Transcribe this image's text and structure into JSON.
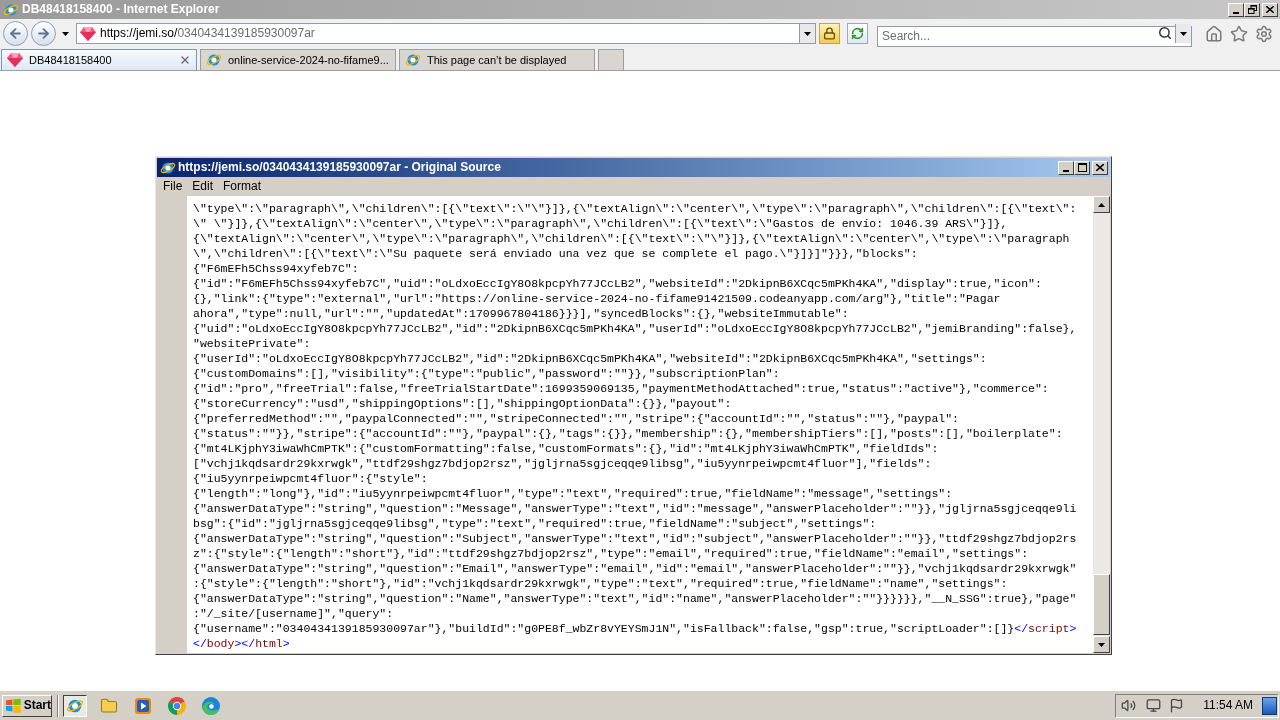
{
  "browser": {
    "title": "DB48418158400 - Internet Explorer",
    "address": {
      "host": "https://jemi.so/",
      "path": "0340434139185930097ar"
    },
    "search": {
      "placeholder": "Search..."
    },
    "tabs": [
      {
        "label": "DB48418158400",
        "kind": "site",
        "selected": true
      },
      {
        "label": "online-service-2024-no-fifame9...",
        "kind": "default",
        "selected": false
      },
      {
        "label": "This page can’t be displayed",
        "kind": "default",
        "selected": false
      }
    ]
  },
  "source_window": {
    "title": "https://jemi.so/0340434139185930097ar - Original Source",
    "menu": [
      "File",
      "Edit",
      "Format"
    ],
    "lines": [
      [
        {
          "kind": "text",
          "text": "\\\"type\\\":\\\"paragraph\\\",\\\"children\\\":[{\\\"text\\\":\\\"\\\"}]},{\\\"textAlign\\\":\\\"center\\\",\\\"type\\\":\\\"paragraph\\\",\\\"children\\\":[{\\\"text\\\":"
        }
      ],
      [
        {
          "kind": "text",
          "text": "\\\" \\\"}]},{\\\"textAlign\\\":\\\"center\\\",\\\"type\\\":\\\"paragraph\\\",\\\"children\\\":[{\\\"text\\\":\\\"Gastos de envío: 1046.39 ARS\\\"}]},"
        }
      ],
      [
        {
          "kind": "text",
          "text": "{\\\"textAlign\\\":\\\"center\\\",\\\"type\\\":\\\"paragraph\\\",\\\"children\\\":[{\\\"text\\\":\\\"\\\"}]},{\\\"textAlign\\\":\\\"center\\\",\\\"type\\\":\\\"paragraph"
        }
      ],
      [
        {
          "kind": "text",
          "text": "\\\",\\\"children\\\":[{\\\"text\\\":\\\"Su paquete será enviado una vez que se complete el pago.\\\"}]}]\"}}},\"blocks\":"
        }
      ],
      [
        {
          "kind": "text",
          "text": "{\"F6mEFh5Chss94xyfeb7C\":"
        }
      ],
      [
        {
          "kind": "text",
          "text": "{\"id\":\"F6mEFh5Chss94xyfeb7C\",\"uid\":\"oLdxoEccIgY8O8kpcpYh77JCcLB2\",\"websiteId\":\"2DkipnB6XCqc5mPKh4KA\",\"display\":true,\"icon\":"
        }
      ],
      [
        {
          "kind": "text",
          "text": "{},\"link\":{\"type\":\"external\",\"url\":\"https://online-service-2024-no-fifame91421509.codeanyapp.com/arg\"},\"title\":\"Pagar"
        }
      ],
      [
        {
          "kind": "text",
          "text": "ahora\",\"type\":null,\"url\":\"\",\"updatedAt\":1709967804186}}}],\"syncedBlocks\":{},\"websiteImmutable\":"
        }
      ],
      [
        {
          "kind": "text",
          "text": "{\"uid\":\"oLdxoEccIgY8O8kpcpYh77JCcLB2\",\"id\":\"2DkipnB6XCqc5mPKh4KA\",\"userId\":\"oLdxoEccIgY8O8kpcpYh77JCcLB2\",\"jemiBranding\":false},"
        }
      ],
      [
        {
          "kind": "text",
          "text": "\"websitePrivate\":"
        }
      ],
      [
        {
          "kind": "text",
          "text": "{\"userId\":\"oLdxoEccIgY8O8kpcpYh77JCcLB2\",\"id\":\"2DkipnB6XCqc5mPKh4KA\",\"websiteId\":\"2DkipnB6XCqc5mPKh4KA\",\"settings\":"
        }
      ],
      [
        {
          "kind": "text",
          "text": "{\"customDomains\":[],\"visibility\":{\"type\":\"public\",\"password\":\"\"}},\"subscriptionPlan\":"
        }
      ],
      [
        {
          "kind": "text",
          "text": "{\"id\":\"pro\",\"freeTrial\":false,\"freeTrialStartDate\":1699359069135,\"paymentMethodAttached\":true,\"status\":\"active\"},\"commerce\":"
        }
      ],
      [
        {
          "kind": "text",
          "text": "{\"storeCurrency\":\"usd\",\"shippingOptions\":[],\"shippingOptionData\":{}},\"payout\":"
        }
      ],
      [
        {
          "kind": "text",
          "text": "{\"preferredMethod\":\"\",\"paypalConnected\":\"\",\"stripeConnected\":\"\",\"stripe\":{\"accountId\":\"\",\"status\":\"\"},\"paypal\":"
        }
      ],
      [
        {
          "kind": "text",
          "text": "{\"status\":\"\"}},\"stripe\":{\"accountId\":\"\"},\"paypal\":{},\"tags\":{}},\"membership\":{},\"membershipTiers\":[],\"posts\":[],\"boilerplate\":"
        }
      ],
      [
        {
          "kind": "text",
          "text": "{\"mt4LKjphY3iwaWhCmPTK\":{\"customFormatting\":false,\"customFormats\":{},\"id\":\"mt4LKjphY3iwaWhCmPTK\",\"fieldIds\":"
        }
      ],
      [
        {
          "kind": "text",
          "text": "[\"vchj1kqdsardr29kxrwgk\",\"ttdf29shgz7bdjop2rsz\",\"jgljrna5sgjceqqe9libsg\",\"iu5yynrpeiwpcmt4fluor\"],\"fields\":"
        }
      ],
      [
        {
          "kind": "text",
          "text": "{\"iu5yynrpeiwpcmt4fluor\":{\"style\":"
        }
      ],
      [
        {
          "kind": "text",
          "text": "{\"length\":\"long\"},\"id\":\"iu5yynrpeiwpcmt4fluor\",\"type\":\"text\",\"required\":true,\"fieldName\":\"message\",\"settings\":"
        }
      ],
      [
        {
          "kind": "text",
          "text": "{\"answerDataType\":\"string\",\"question\":\"Message\",\"answerType\":\"text\",\"id\":\"message\",\"answerPlaceholder\":\"\"}},\"jgljrna5sgjceqqe9li"
        }
      ],
      [
        {
          "kind": "text",
          "text": "bsg\":{\"id\":\"jgljrna5sgjceqqe9libsg\",\"type\":\"text\",\"required\":true,\"fieldName\":\"subject\",\"settings\":"
        }
      ],
      [
        {
          "kind": "text",
          "text": "{\"answerDataType\":\"string\",\"question\":\"Subject\",\"answerType\":\"text\",\"id\":\"subject\",\"answerPlaceholder\":\"\"}},\"ttdf29shgz7bdjop2rs"
        }
      ],
      [
        {
          "kind": "text",
          "text": "z\":{\"style\":{\"length\":\"short\"},\"id\":\"ttdf29shgz7bdjop2rsz\",\"type\":\"email\",\"required\":true,\"fieldName\":\"email\",\"settings\":"
        }
      ],
      [
        {
          "kind": "text",
          "text": "{\"answerDataType\":\"string\",\"question\":\"Email\",\"answerType\":\"email\",\"id\":\"email\",\"answerPlaceholder\":\"\"}},\"vchj1kqdsardr29kxrwgk\""
        }
      ],
      [
        {
          "kind": "text",
          "text": ":{\"style\":{\"length\":\"short\"},\"id\":\"vchj1kqdsardr29kxrwgk\",\"type\":\"text\",\"required\":true,\"fieldName\":\"name\",\"settings\":"
        }
      ],
      [
        {
          "kind": "text",
          "text": "{\"answerDataType\":\"string\",\"question\":\"Name\",\"answerType\":\"text\",\"id\":\"name\",\"answerPlaceholder\":\"\"}}}}}},\"__N_SSG\":true},\"page\""
        }
      ],
      [
        {
          "kind": "text",
          "text": ":\"/_site/[username]\",\"query\":"
        }
      ],
      [
        {
          "kind": "text",
          "text": "{\"username\":\"0340434139185930097ar\"},\"buildId\":\"g0PE8f_wbZr8vYEYSmJ1N\",\"isFallback\":false,\"gsp\":true,\"scriptLoader\":[]}"
        },
        {
          "kind": "delim",
          "text": "</"
        },
        {
          "kind": "tag",
          "text": "script"
        },
        {
          "kind": "delim",
          "text": ">"
        }
      ],
      [
        {
          "kind": "delim",
          "text": "</"
        },
        {
          "kind": "tag",
          "text": "body"
        },
        {
          "kind": "delim",
          "text": "></"
        },
        {
          "kind": "tag",
          "text": "html"
        },
        {
          "kind": "delim",
          "text": ">"
        }
      ]
    ]
  },
  "taskbar": {
    "start": "Start",
    "apps": [
      {
        "kind": "ie",
        "active": true
      },
      {
        "kind": "folder",
        "active": false
      },
      {
        "kind": "media",
        "active": false
      },
      {
        "kind": "chrome",
        "active": false
      },
      {
        "kind": "edge",
        "active": false
      }
    ],
    "clock": "11:54 AM"
  }
}
